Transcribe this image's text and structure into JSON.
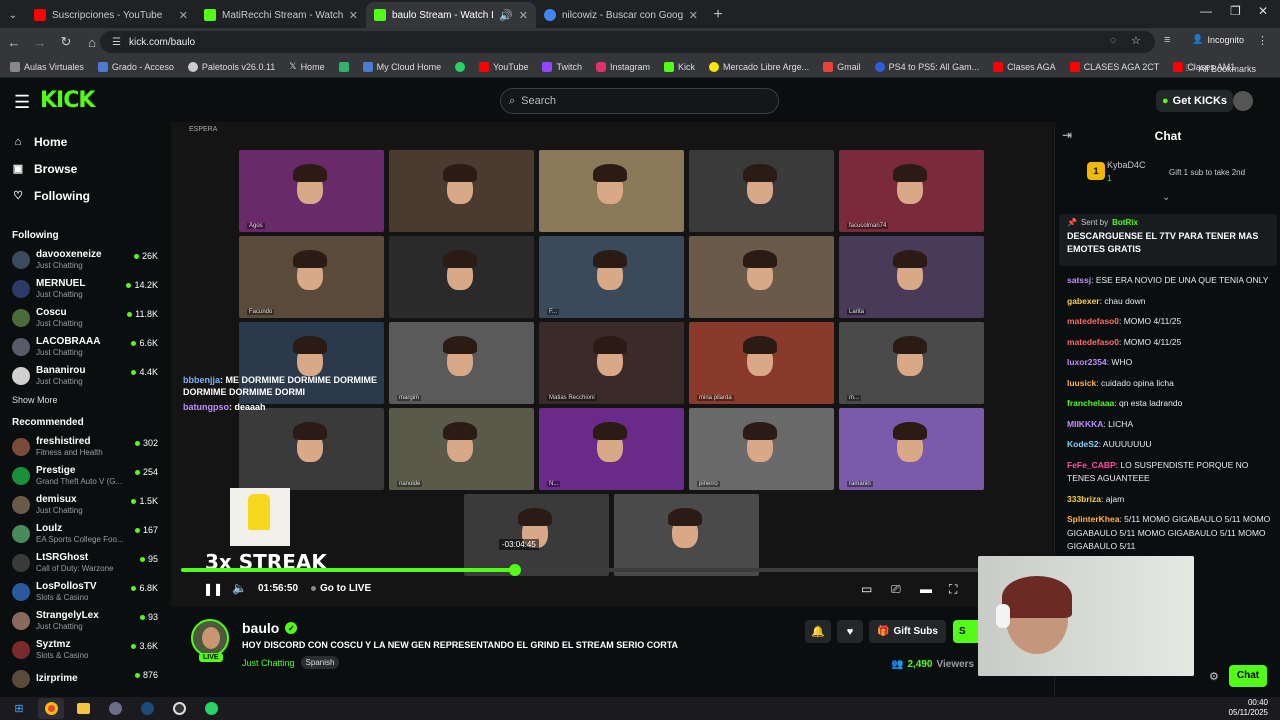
{
  "browser": {
    "tabs": [
      {
        "title": "Suscripciones - YouTube",
        "icon": "youtube-icon",
        "color": "#ff0000"
      },
      {
        "title": "MatiRecchi Stream - Watch Live",
        "icon": "kick-icon",
        "color": "#53fc18"
      },
      {
        "title": "baulo Stream - Watch Live",
        "icon": "kick-icon",
        "color": "#53fc18",
        "active": true
      },
      {
        "title": "nilcowiz - Buscar con Google",
        "icon": "google-icon",
        "color": "#4285f4"
      }
    ],
    "url": "kick.com/baulo",
    "incognito_label": "Incognito",
    "bookmarks": [
      "Aulas Virtuales",
      "Grado - Acceso",
      "Paletools v26.0.11",
      "Home",
      "",
      "My Cloud Home",
      "",
      "YouTube",
      "Twitch",
      "Instagram",
      "Kick",
      "Mercado Libre Arge...",
      "Gmail",
      "PS4 to PS5: All Gam...",
      "Clases AGA",
      "CLASES AGA 2CT",
      "Clases AM1"
    ],
    "all_bookmarks": "All Bookmarks"
  },
  "kick": {
    "logo": "KICK",
    "search_placeholder": "Search",
    "get_kicks": "Get KICKs"
  },
  "sidebar": {
    "nav": [
      {
        "label": "Home",
        "icon": "home-icon"
      },
      {
        "label": "Browse",
        "icon": "browse-icon"
      },
      {
        "label": "Following",
        "icon": "heart-icon"
      }
    ],
    "following_title": "Following",
    "following": [
      {
        "name": "davooxeneize",
        "category": "Just Chatting",
        "viewers": "26K",
        "color": "#3b4a5c"
      },
      {
        "name": "MERNUEL",
        "category": "Just Chatting",
        "viewers": "14.2K",
        "color": "#2c3a66"
      },
      {
        "name": "Coscu",
        "category": "Just Chatting",
        "viewers": "11.8K",
        "color": "#4a6b3a"
      },
      {
        "name": "LACOBRAAA",
        "category": "Just Chatting",
        "viewers": "6.6K",
        "color": "#5a5a6a"
      },
      {
        "name": "Bananirou",
        "category": "Just Chatting",
        "viewers": "4.4K",
        "color": "#d0d0d0"
      }
    ],
    "show_more": "Show More",
    "recommended_title": "Recommended",
    "recommended": [
      {
        "name": "freshistired",
        "category": "Fitness and Health",
        "viewers": "302",
        "color": "#7a4a3a"
      },
      {
        "name": "Prestige",
        "category": "Grand Theft Auto V (G...",
        "viewers": "254",
        "color": "#1a8f3a"
      },
      {
        "name": "demisux",
        "category": "Just Chatting",
        "viewers": "1.5K",
        "color": "#6a5a4a"
      },
      {
        "name": "Loulz",
        "category": "EA Sports College Foo...",
        "viewers": "167",
        "color": "#4a8a5a"
      },
      {
        "name": "LtSRGhost",
        "category": "Call of Duty: Warzone",
        "viewers": "95",
        "color": "#3a3a3a"
      },
      {
        "name": "LosPollosTV",
        "category": "Slots & Casino",
        "viewers": "6.8K",
        "color": "#2a5a9a"
      },
      {
        "name": "StrangelyLex",
        "category": "Just Chatting",
        "viewers": "93",
        "color": "#8a6a5a"
      },
      {
        "name": "Syztmz",
        "category": "Slots & Casino",
        "viewers": "3.6K",
        "color": "#7a2a2a"
      },
      {
        "name": "Izirprime",
        "category": "",
        "viewers": "876",
        "color": "#5a4a3a"
      }
    ]
  },
  "video": {
    "room_label": "ESPERA",
    "participants": [
      "Agos",
      "",
      "",
      "",
      "facucolman74",
      "Facundo",
      "",
      "F...",
      "",
      "Larita",
      "",
      "margim",
      "Matias Recchioni",
      "mina pilarda",
      "m...",
      "",
      "nanoide",
      "N...",
      "pinerro",
      "ramanin",
      "",
      ""
    ],
    "chat_overlay": [
      {
        "user": "bbbenjja",
        "text": ": ME DORMIME DORMIME DORMIME DORMIME DORMIME DORMI"
      },
      {
        "user": "batungpso",
        "text": ": deaaah"
      }
    ],
    "streak": "3x STREAK",
    "time": "01:56:50",
    "go_live": "Go to LIVE",
    "hover_time": "-03:04:45",
    "progress_fraction": 0.388
  },
  "stream": {
    "name": "baulo",
    "live": "LIVE",
    "title": "HOY DISCORD CON COSCU Y LA NEW GEN REPRESENTANDO EL GRIND EL STREAM SERIO CORTA",
    "category": "Just Chatting",
    "language": "Spanish",
    "gift_subs": "Gift Subs",
    "subscribe_partial": "S",
    "viewers": "2,490",
    "viewers_label": "Viewers"
  },
  "chat": {
    "title": "Chat",
    "pinned": {
      "user": "KybaD4C",
      "count": "1",
      "message": "Gift 1 sub to take 2nd",
      "rank": "1"
    },
    "announcement": {
      "sent_by": "Sent by",
      "bot": "BotRix",
      "text": "DESCARGUENSE EL 7TV PARA TENER MAS EMOTES GRATIS"
    },
    "messages": [
      {
        "user": "satssj",
        "text": ": ESE ERA NOVIO DE UNA QUE TENIA ONLY",
        "color": "#c08cff"
      },
      {
        "user": "gabexer",
        "text": ": chau down",
        "color": "#f5d142"
      },
      {
        "user": "matedefaso0",
        "text": ": MOMO 4/11/25",
        "color": "#ff6b6b"
      },
      {
        "user": "matedefaso0",
        "text": ": MOMO 4/11/25",
        "color": "#ff6b6b"
      },
      {
        "user": "luxor2354",
        "text": ": WHO",
        "color": "#c08cff"
      },
      {
        "user": "luusick",
        "text": ": cuidado opina licha",
        "color": "#ffb347"
      },
      {
        "user": "franchelaaa",
        "text": ": qn esta ladrando",
        "color": "#53fc18"
      },
      {
        "user": "MIIKKKA",
        "text": ": LICHA",
        "color": "#c08cff"
      },
      {
        "user": "KodeS2",
        "text": ": AUUUUUUU",
        "color": "#7fd0ff"
      },
      {
        "user": "FeFe_CABP",
        "text": ": LO SUSPENDISTE PORQUE NO TENES AGUANTEEE",
        "color": "#ff4fa0"
      },
      {
        "user": "333briza",
        "text": ": ajam",
        "color": "#f5d142"
      },
      {
        "user": "SplinterKhea",
        "text": ": 5/11 MOMO GIGABAULO 5/11 MOMO GIGABAULO 5/11 MOMO GIGABAULO 5/11 MOMO GIGABAULO 5/11",
        "color": "#ffb347"
      }
    ],
    "chat_button": "Chat"
  },
  "taskbar": {
    "time": "00:40",
    "date": "05/11/2025"
  }
}
